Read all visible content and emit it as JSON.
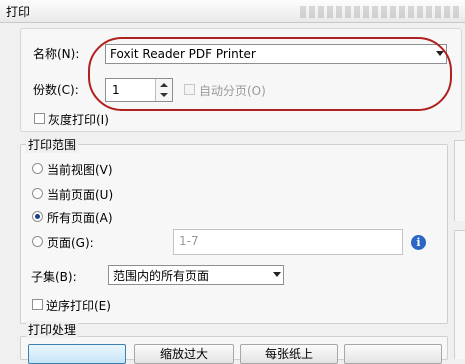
{
  "window": {
    "title": "打印"
  },
  "printer": {
    "name_label": "名称(N):",
    "selected": "Foxit Reader PDF Printer",
    "copies_label": "份数(C):",
    "copies_value": "1",
    "collate_label": "自动分页(O)",
    "grayscale_label": "灰度打印(I)"
  },
  "print_range": {
    "group_title": "打印范围",
    "options": [
      "当前视图(V)",
      "当前页面(U)",
      "所有页面(A)",
      "页面(G):"
    ],
    "selected_option": "所有页面(A)",
    "pages_placeholder": "1-7",
    "subset_label": "子集(B):",
    "subset_value": "范围内的所有页面",
    "reverse_label": "逆序打印(E)"
  },
  "print_handling": {
    "group_title": "打印处理",
    "buttons": [
      "",
      "缩放过大",
      "每张纸上",
      ""
    ]
  },
  "colors": {
    "highlight": "#b0201f",
    "info": "#2a67c5"
  }
}
